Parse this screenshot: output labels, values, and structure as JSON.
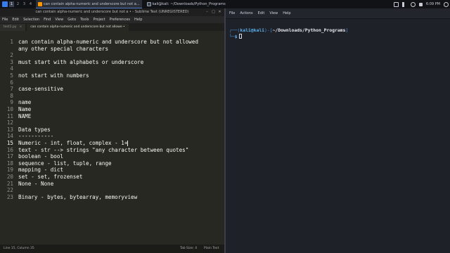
{
  "taskbar": {
    "workspaces": [
      "1",
      "2",
      "3",
      "4"
    ],
    "tasks": [
      {
        "label": "can contain alpha-numeric and underscore but not a..."
      },
      {
        "label": "kali@kali: ~/Downloads/Python_Programs"
      }
    ],
    "time": "6:09 PM"
  },
  "sublime": {
    "title": "can contain alpha-numeric and underscore but not a • - Sublime Text (UNREGISTERED)",
    "menu": [
      "File",
      "Edit",
      "Selection",
      "Find",
      "View",
      "Goto",
      "Tools",
      "Project",
      "Preferences",
      "Help"
    ],
    "tabs": [
      {
        "label": "test1.py"
      },
      {
        "label": "can contain alpha-numeric and underscore but not allowe •"
      }
    ],
    "lines": [
      {
        "num": "1",
        "text": "can contain alpha-numeric and underscore but not allowed"
      },
      {
        "num": "",
        "text": "any other special characters"
      },
      {
        "num": "2",
        "text": ""
      },
      {
        "num": "3",
        "text": "must start with alphabets or underscore"
      },
      {
        "num": "4",
        "text": ""
      },
      {
        "num": "5",
        "text": "not start with numbers"
      },
      {
        "num": "6",
        "text": ""
      },
      {
        "num": "7",
        "text": "case-sensitive"
      },
      {
        "num": "8",
        "text": ""
      },
      {
        "num": "9",
        "text": "name"
      },
      {
        "num": "10",
        "text": "Name"
      },
      {
        "num": "11",
        "text": "NAME"
      },
      {
        "num": "12",
        "text": ""
      },
      {
        "num": "13",
        "text": "Data types"
      },
      {
        "num": "14",
        "text": "-----------"
      },
      {
        "num": "15",
        "text": "Numeric - int, float, complex - 1+"
      },
      {
        "num": "16",
        "text": "text - str --> strings \"any character between quotes\""
      },
      {
        "num": "17",
        "text": "boolean - bool"
      },
      {
        "num": "18",
        "text": "sequence - list, tuple, range"
      },
      {
        "num": "19",
        "text": "mapping - dict"
      },
      {
        "num": "20",
        "text": "set - set, frozenset"
      },
      {
        "num": "21",
        "text": "None - None"
      },
      {
        "num": "22",
        "text": ""
      },
      {
        "num": "23",
        "text": "Binary - bytes, bytearray, memoryview"
      }
    ],
    "current_line": "15",
    "status": {
      "position": "Line 15, Column 35",
      "tab_size": "Tab Size: 4",
      "syntax": "Plain Text"
    }
  },
  "terminal": {
    "menu": [
      "File",
      "Actions",
      "Edit",
      "View",
      "Help"
    ],
    "prompt_user": "kali",
    "prompt_at": "@",
    "prompt_host": "kali",
    "prompt_dir": "~/Downloads/Python_Programs",
    "prompt_symbol": "$"
  }
}
